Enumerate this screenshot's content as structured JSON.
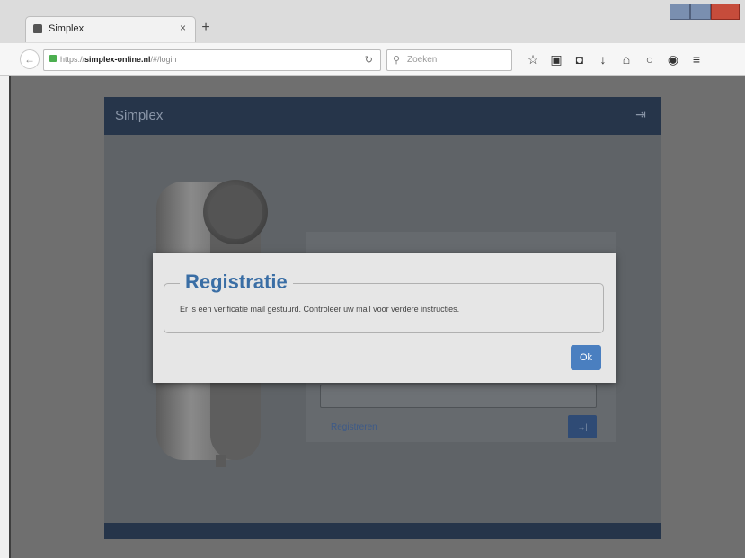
{
  "browser": {
    "tab_title": "Simplex",
    "tab_close": "×",
    "new_tab": "+",
    "url_prefix": "https://",
    "url_domain": "simplex-online.nl",
    "url_path": "/#/login",
    "search_placeholder": "Zoeken",
    "icons": [
      "star-icon",
      "clipboard-icon",
      "pocket-icon",
      "download-icon",
      "home-icon",
      "chat-icon",
      "extension-icon",
      "menu-icon"
    ]
  },
  "app": {
    "title": "Simplex",
    "register_label": "Registreren"
  },
  "modal": {
    "title": "Registratie",
    "message": "Er is een verificatie mail gestuurd. Controleer uw mail voor verdere instructies.",
    "ok_label": "Ok"
  },
  "colors": {
    "header": "#26354a",
    "accent": "#3a6ea5",
    "ok_button": "#4a7fc0"
  }
}
